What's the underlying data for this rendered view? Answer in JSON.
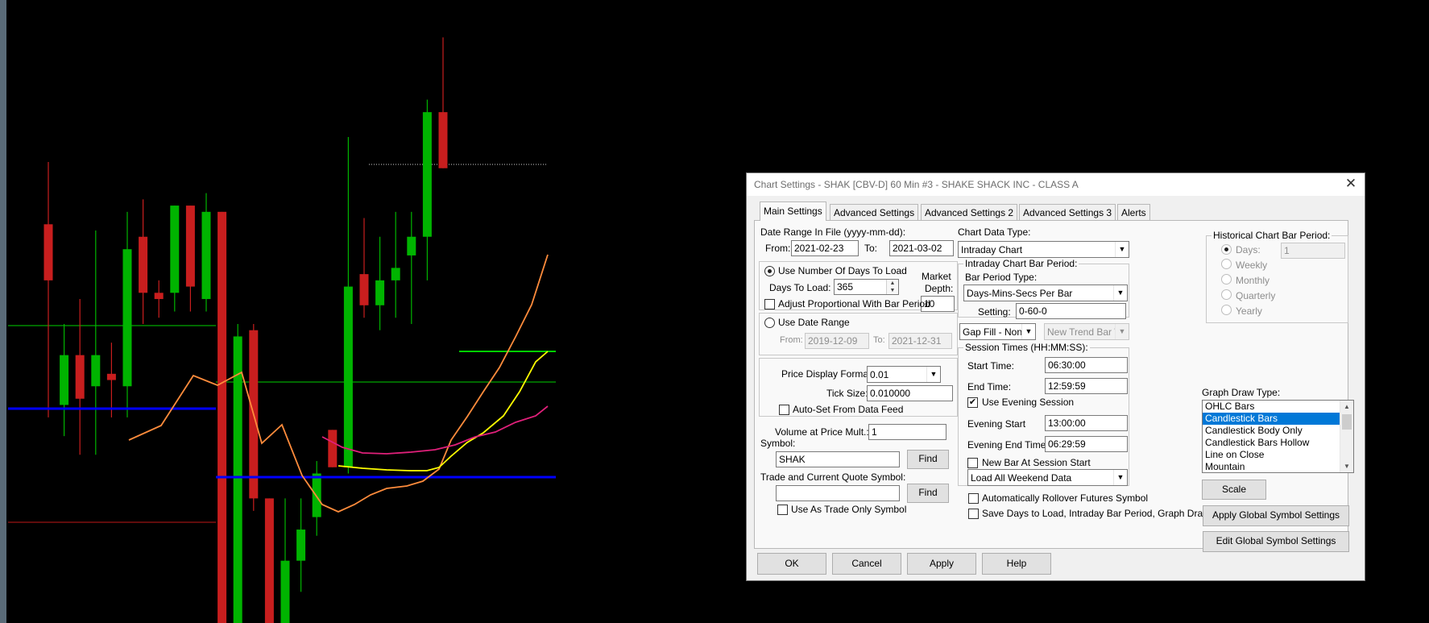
{
  "dialog": {
    "title": "Chart Settings - SHAK [CBV-D]  60 Min  #3 - SHAKE SHACK INC - CLASS A",
    "close_glyph": "✕",
    "tabs": [
      "Main Settings",
      "Advanced Settings",
      "Advanced Settings 2",
      "Advanced Settings 3",
      "Alerts"
    ],
    "active_tab": "Main Settings"
  },
  "date_range": {
    "heading": "Date Range In File (yyyy-mm-dd):",
    "from_label": "From:",
    "from_value": "2021-02-23",
    "to_label": "To:",
    "to_value": "2021-03-02"
  },
  "days_group": {
    "use_days_label": "Use Number Of Days To Load",
    "days_to_load_label": "Days To Load:",
    "days_to_load_value": "365",
    "market_depth_label1": "Market",
    "market_depth_label2": "Depth:",
    "market_depth_value": "10",
    "adjust_label": "Adjust Proportional With Bar Period",
    "adjust_checked": false,
    "use_days_selected": true
  },
  "date_range_group": {
    "use_date_range_label": "Use Date Range",
    "from_label": "From:",
    "from_value": "2019-12-09",
    "to_label": "To:",
    "to_value": "2021-12-31"
  },
  "price_group": {
    "price_format_label": "Price Display Format:",
    "price_format_value": "0.01",
    "tick_size_label": "Tick Size:",
    "tick_size_value": "0.010000",
    "auto_set_label": "Auto-Set From Data Feed",
    "auto_set_checked": false
  },
  "symbol_area": {
    "volume_label": "Volume at Price Mult.:",
    "volume_value": "1",
    "symbol_label": "Symbol:",
    "symbol_value": "SHAK",
    "find_label": "Find",
    "trade_symbol_label": "Trade and Current Quote Symbol:",
    "trade_symbol_value": "",
    "trade_only_label": "Use As Trade Only Symbol",
    "trade_only_checked": false
  },
  "chart_data_type": {
    "label": "Chart Data Type:",
    "value": "Intraday Chart"
  },
  "intraday_group": {
    "title": "Intraday Chart Bar Period:",
    "bar_period_type_label": "Bar Period Type:",
    "bar_period_type_value": "Days-Mins-Secs Per Bar",
    "setting_label": "Setting:",
    "setting_value": "0-60-0"
  },
  "gap_fill": {
    "value": "Gap Fill - None"
  },
  "new_trend": {
    "value": "New Trend Bar W"
  },
  "session_group": {
    "title": "Session Times (HH:MM:SS):",
    "start_label": "Start Time:",
    "start_value": "06:30:00",
    "end_label": "End Time:",
    "end_value": "12:59:59",
    "evening_label": "Use Evening Session",
    "evening_checked": true,
    "evening_start_label": "Evening Start",
    "evening_start_value": "13:00:00",
    "evening_end_label": "Evening End Time:",
    "evening_end_value": "06:29:59",
    "new_bar_label": "New Bar At Session Start",
    "new_bar_checked": false,
    "weekend_value": "Load All Weekend Data"
  },
  "historical_group": {
    "title": "Historical Chart Bar Period:",
    "options": [
      "Days:",
      "Weekly",
      "Monthly",
      "Quarterly",
      "Yearly"
    ],
    "days_value": "1"
  },
  "graph_draw": {
    "label": "Graph Draw Type:",
    "items": [
      "OHLC Bars",
      "Candlestick Bars",
      "Candlestick Body Only",
      "Candlestick Bars Hollow",
      "Line on Close",
      "Mountain"
    ],
    "selected": "Candlestick Bars"
  },
  "right_buttons": {
    "scale": "Scale",
    "apply_global": "Apply Global Symbol Settings",
    "edit_global": "Edit Global Symbol Settings"
  },
  "bottom_checks": {
    "rollover_label": "Automatically Rollover Futures Symbol",
    "rollover_checked": false,
    "save_default_label": "Save Days to Load, Intraday Bar Period, Graph Draw Type as Default",
    "save_default_checked": false
  },
  "footer_buttons": {
    "ok": "OK",
    "cancel": "Cancel",
    "apply": "Apply",
    "help": "Help"
  },
  "glyphs": {
    "check": "✔",
    "down": "▼",
    "up": "▲",
    "spin_up": "▲",
    "spin_down": "▼"
  },
  "colors": {
    "background": "#000000",
    "up_candle": "#00b400",
    "down_candle": "#c81e1e",
    "blue_line": "#0000ff",
    "green_line": "#00d000",
    "red_line": "#c01818",
    "orange_ma": "#ff8c3c",
    "yellow_ma": "#ffff00",
    "magenta_ma": "#e0207a",
    "selection": "#0078d7"
  },
  "chart_data": {
    "type": "candlestick",
    "note": "Price chart behind dialog; no axis labels visible",
    "candles": [
      {
        "dir": "down",
        "o": 0.64,
        "c": 0.55,
        "h": 0.74,
        "l": 0.33
      },
      {
        "dir": "up",
        "o": 0.35,
        "c": 0.43,
        "h": 0.48,
        "l": 0.3
      },
      {
        "dir": "down",
        "o": 0.43,
        "c": 0.36,
        "h": 0.52,
        "l": 0.27
      },
      {
        "dir": "up",
        "o": 0.38,
        "c": 0.43,
        "h": 0.63,
        "l": 0.27
      },
      {
        "dir": "down",
        "o": 0.4,
        "c": 0.39,
        "h": 0.45,
        "l": 0.33
      },
      {
        "dir": "up",
        "o": 0.38,
        "c": 0.6,
        "h": 0.66,
        "l": 0.33
      },
      {
        "dir": "down",
        "o": 0.62,
        "c": 0.53,
        "h": 0.68,
        "l": 0.48
      },
      {
        "dir": "down",
        "o": 0.53,
        "c": 0.52,
        "h": 0.55,
        "l": 0.49
      },
      {
        "dir": "up",
        "o": 0.53,
        "c": 0.67,
        "h": 0.67,
        "l": 0.5
      },
      {
        "dir": "down",
        "o": 0.67,
        "c": 0.54,
        "h": 0.67,
        "l": 0.5
      },
      {
        "dir": "up",
        "o": 0.52,
        "c": 0.66,
        "h": 0.69,
        "l": 0.5
      },
      {
        "dir": "down",
        "o": 0.66,
        "c": 0.0,
        "h": 0.66,
        "l": 0.0
      },
      {
        "dir": "up",
        "o": 0.0,
        "c": 0.46,
        "h": 0.48,
        "l": 0.0
      },
      {
        "dir": "down",
        "o": 0.47,
        "c": 0.2,
        "h": 0.48,
        "l": 0.18
      },
      {
        "dir": "down",
        "o": 0.2,
        "c": 0.0,
        "h": 0.2,
        "l": 0.0
      },
      {
        "dir": "up",
        "o": 0.0,
        "c": 0.1,
        "h": 0.2,
        "l": 0.0
      },
      {
        "dir": "up",
        "o": 0.1,
        "c": 0.15,
        "h": 0.2,
        "l": 0.05
      },
      {
        "dir": "up",
        "o": 0.17,
        "c": 0.24,
        "h": 0.26,
        "l": 0.14
      },
      {
        "dir": "down",
        "o": 0.31,
        "c": 0.25,
        "h": 0.31,
        "l": 0.25
      },
      {
        "dir": "up",
        "o": 0.25,
        "c": 0.54,
        "h": 0.78,
        "l": 0.24
      },
      {
        "dir": "down",
        "o": 0.56,
        "c": 0.51,
        "h": 0.65,
        "l": 0.49
      },
      {
        "dir": "up",
        "o": 0.51,
        "c": 0.55,
        "h": 0.62,
        "l": 0.47
      },
      {
        "dir": "up",
        "o": 0.55,
        "c": 0.57,
        "h": 0.66,
        "l": 0.49
      },
      {
        "dir": "up",
        "o": 0.59,
        "c": 0.62,
        "h": 0.66,
        "l": 0.48
      },
      {
        "dir": "up",
        "o": 0.62,
        "c": 0.82,
        "h": 0.84,
        "l": 0.55
      },
      {
        "dir": "down",
        "o": 0.82,
        "c": 0.73,
        "h": 0.94,
        "l": 0.73
      }
    ]
  }
}
